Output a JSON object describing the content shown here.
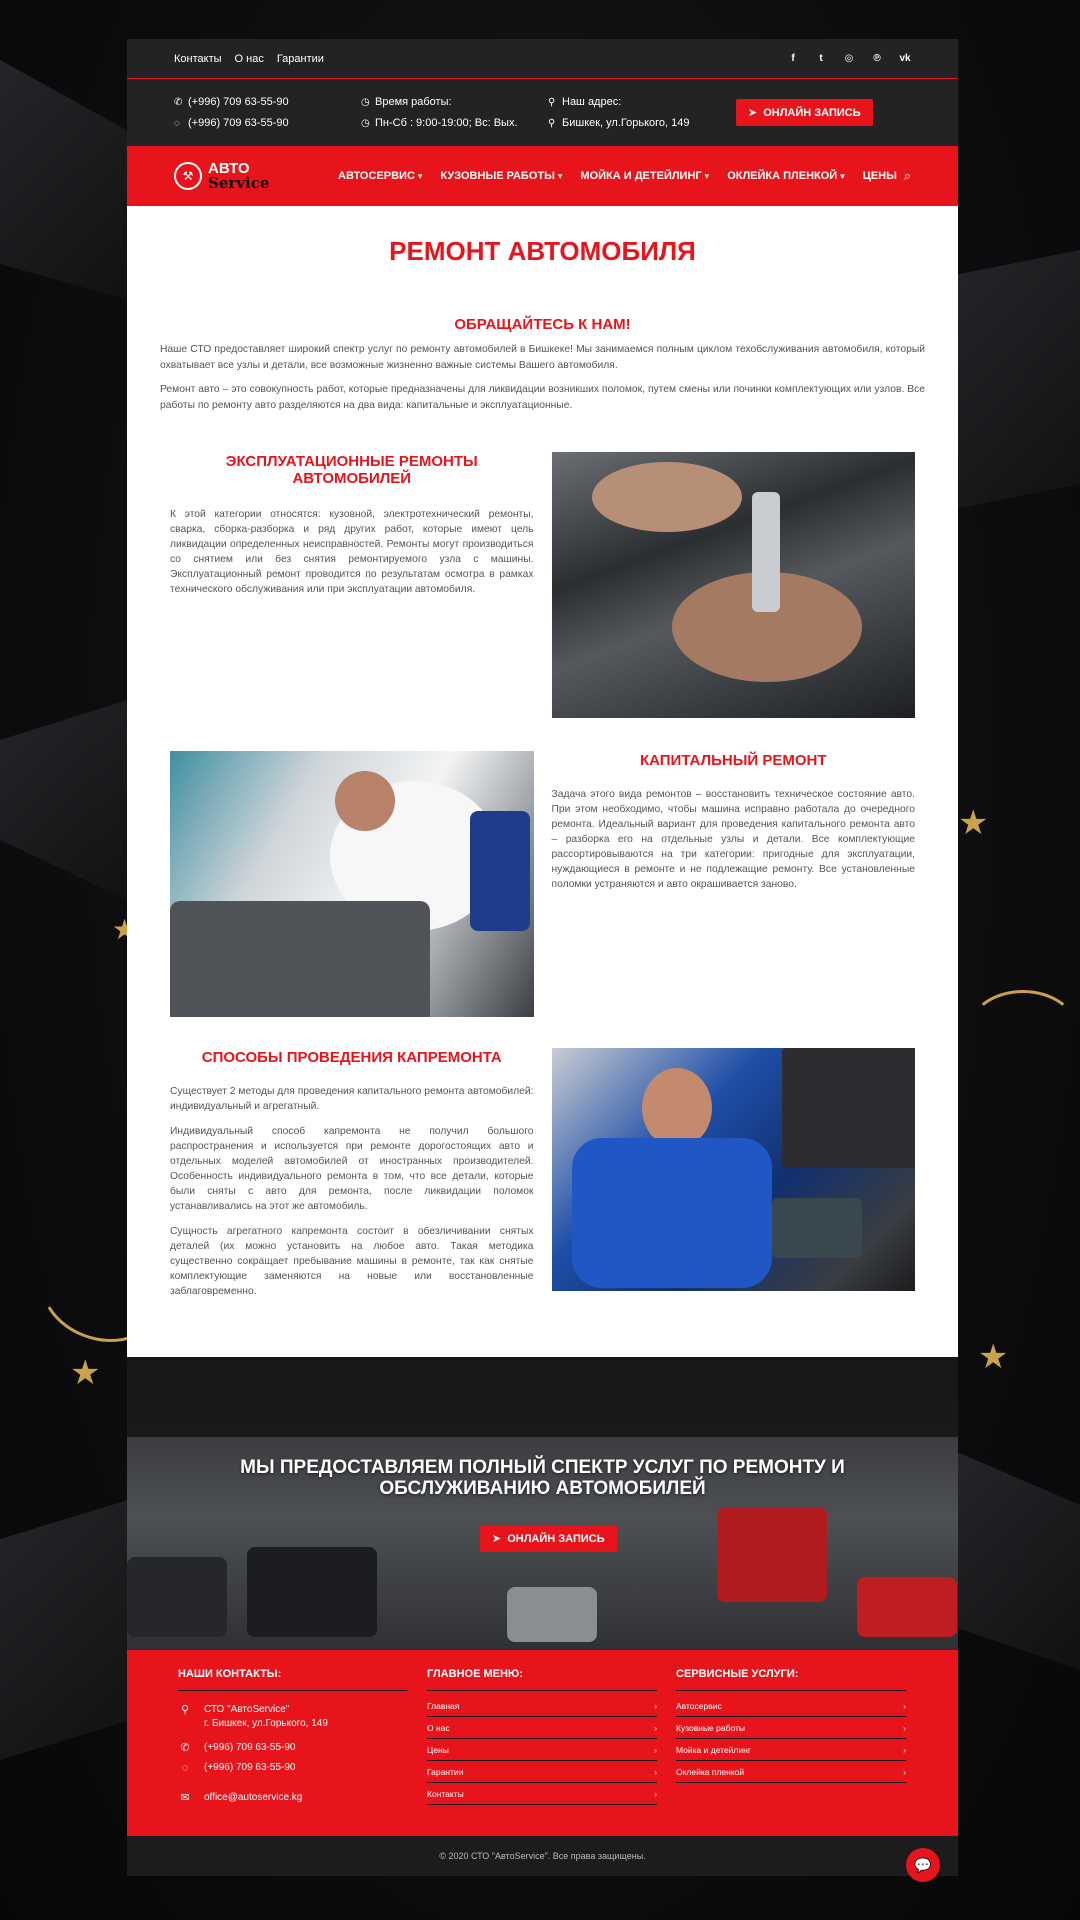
{
  "topbar": {
    "links": [
      "Контакты",
      "О нас",
      "Гарантии"
    ],
    "social_icons": [
      "facebook-icon",
      "twitter-icon",
      "instagram-icon",
      "pinterest-icon",
      "vk-icon"
    ],
    "social_glyphs": [
      "f",
      "t",
      "◎",
      "℗",
      "vk"
    ]
  },
  "info": {
    "phone1": "(+996) 709 63-55-90",
    "phone2": "(+996) 709 63-55-90",
    "hours_label": "Время работы:",
    "hours_value": "Пн-Сб : 9:00-19:00; Вс: Вых.",
    "address_label": "Наш адрес:",
    "address_value": "Бишкек, ул.Горького, 149",
    "cta": "ОНЛАЙН ЗАПИСЬ"
  },
  "logo": {
    "line1": "АВТО",
    "line2": "Service"
  },
  "nav": {
    "items": [
      "АВТОСЕРВИС",
      "КУЗОВНЫЕ РАБОТЫ",
      "МОЙКА И ДЕТЕЙЛИНГ",
      "ОКЛЕЙКА ПЛЕНКОЙ",
      "ЦЕНЫ"
    ]
  },
  "main": {
    "title": "РЕМОНТ АВТОМОБИЛЯ",
    "intro_heading": "ОБРАЩАЙТЕСЬ К НАМ!",
    "intro_p1": "Наше СТО предоставляет широкий спектр услуг по ремонту автомобилей в Бишкеке! Мы занимаемся полным циклом техобслуживания автомобиля, который охватывает все узлы и детали, все возможные жизненно важные системы Вашего автомобиля.",
    "intro_p2": "Ремонт авто – это совокупность работ, которые предназначены для ликвидации возникших поломок, путем смены или починки комплектующих или узлов. Все работы по ремонту авто разделяются на два вида: капитальные и эксплуатационные.",
    "s1_heading": "ЭКСПЛУАТАЦИОННЫЕ РЕМОНТЫ АВТОМОБИЛЕЙ",
    "s1_p": "К этой категории относятся: кузовной, электротехнический ремонты, сварка, сборка-разборка и ряд других работ, которые имеют цель ликвидации определенных неисправностей. Ремонты могут производиться со снятием или без снятия ремонтируемого узла с машины. Эксплуатационный ремонт проводится по результатам осмотра в рамках технического обслуживания или при эксплуатации автомобиля.",
    "s2_heading": "КАПИТАЛЬНЫЙ РЕМОНТ",
    "s2_p": "Задача этого вида ремонтов – восстановить техническое состояние авто. При этом необходимо, чтобы машина исправно работала до очередного ремонта. Идеальный вариант для проведения капитального ремонта авто – разборка его на отдельные узлы и детали. Все комплектующие рассортировываются на три категории: пригодные для эксплуатации, нуждающиеся в ремонте и не подлежащие ремонту. Все установленные поломки устраняются и авто окрашивается заново.",
    "s3_heading": "СПОСОБЫ ПРОВЕДЕНИЯ КАПРЕМОНТА",
    "s3_p1": "Существует 2 методы для проведения капитального ремонта автомобилей: индивидуальный и агрегатный.",
    "s3_p2": "Индивидуальный способ капремонта не получил большого распространения и используется при ремонте дорогостоящих авто и отдельных моделей автомобилей от иностранных производителей. Особенность индивидуального ремонта в том, что все детали, которые были сняты с авто для ремонта, после ликвидации поломок устанавливались на этот же автомобиль.",
    "s3_p3": "Сущность агрегатного капремонта состоит в обезличивании снятых деталей (их можно установить на любое авто. Такая методика существенно сокращает пребывание машины в ремонте, так как снятые комплектующие заменяются на новые или восстановленные заблаговременно."
  },
  "banner": {
    "heading": "МЫ ПРЕДОСТАВЛЯЕМ ПОЛНЫЙ СПЕКТР УСЛУГ ПО РЕМОНТУ И ОБСЛУЖИВАНИЮ АВТОМОБИЛЕЙ",
    "cta": "ОНЛАЙН ЗАПИСЬ"
  },
  "footer": {
    "contacts_title": "НАШИ КОНТАКТЫ:",
    "company": "СТО \"АвтоService\"",
    "address": "г. Бишкек, ул.Горького, 149",
    "phone1": "(+996) 709 63-55-90",
    "phone2": "(+996) 709 63-55-90",
    "email": "office@autoservice.kg",
    "menu_title": "ГЛАВНОЕ МЕНЮ:",
    "menu_items": [
      "Главная",
      "О нас",
      "Цены",
      "Гарантии",
      "Контакты"
    ],
    "services_title": "СЕРВИСНЫЕ УСЛУГИ:",
    "service_items": [
      "Автосервис",
      "Кузовные работы",
      "Мойка и детейлинг",
      "Оклейка пленкой"
    ],
    "copyright": "© 2020 СТО \"АвтоService\". Все права защищены."
  },
  "colors": {
    "accent": "#e8141c",
    "dark": "#232325",
    "gold": "#c9a24a"
  }
}
